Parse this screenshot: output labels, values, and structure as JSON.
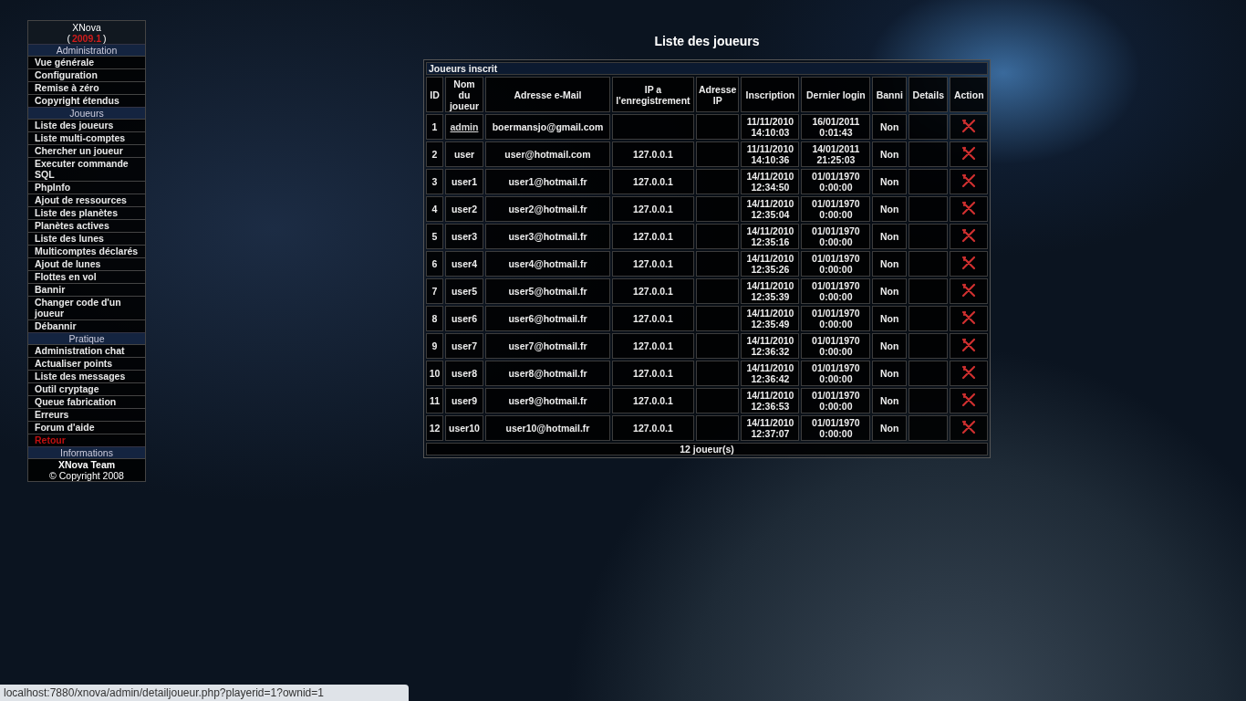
{
  "sidebar": {
    "brand": "XNova",
    "version_prefix": "(",
    "version": "2009.1",
    "version_suffix": ")",
    "sections": [
      {
        "title": "Administration",
        "items": [
          {
            "label": "Vue générale",
            "kind": "link"
          },
          {
            "label": "Configuration",
            "kind": "link"
          },
          {
            "label": "Remise à zéro",
            "kind": "link"
          },
          {
            "label": "Copyright étendus",
            "kind": "link"
          }
        ]
      },
      {
        "title": "Joueurs",
        "items": [
          {
            "label": "Liste des joueurs",
            "kind": "link"
          },
          {
            "label": "Liste multi-comptes",
            "kind": "link"
          },
          {
            "label": "Chercher un joueur",
            "kind": "link"
          },
          {
            "label": "Executer commande SQL",
            "kind": "link"
          },
          {
            "label": "PhpInfo",
            "kind": "link"
          },
          {
            "label": "Ajout de ressources",
            "kind": "link"
          },
          {
            "label": "Liste des planètes",
            "kind": "link"
          },
          {
            "label": "Planètes actives",
            "kind": "link"
          },
          {
            "label": "Liste des lunes",
            "kind": "link"
          },
          {
            "label": "Multicomptes déclarés",
            "kind": "link"
          },
          {
            "label": "Ajout de lunes",
            "kind": "link"
          },
          {
            "label": "Flottes en vol",
            "kind": "link"
          },
          {
            "label": "Bannir",
            "kind": "link"
          },
          {
            "label": "Changer code d'un joueur",
            "kind": "link"
          },
          {
            "label": "Débannir",
            "kind": "link"
          }
        ]
      },
      {
        "title": "Pratique",
        "items": [
          {
            "label": "Administration chat",
            "kind": "link"
          },
          {
            "label": "Actualiser points",
            "kind": "link"
          },
          {
            "label": "Liste des messages",
            "kind": "link"
          },
          {
            "label": "Outil cryptage",
            "kind": "link"
          },
          {
            "label": "Queue fabrication",
            "kind": "link"
          },
          {
            "label": "Erreurs",
            "kind": "link"
          },
          {
            "label": "Forum d'aide",
            "kind": "link"
          },
          {
            "label": "Retour",
            "kind": "exit"
          }
        ]
      },
      {
        "title": "Informations"
      }
    ],
    "footer": [
      "XNova Team",
      "© Copyright 2008"
    ]
  },
  "page_title": "Liste des joueurs",
  "table": {
    "caption": "Joueurs inscrit",
    "columns": [
      "ID",
      "Nom du joueur",
      "Adresse e-Mail",
      "IP a l'enregistrement",
      "Adresse IP",
      "Inscription",
      "Dernier login",
      "Banni",
      "Details",
      "Action"
    ],
    "rows": [
      {
        "id": "1",
        "name": "admin",
        "name_link": true,
        "email": "boermansjo@gmail.com",
        "ip_registration": "",
        "ip": "",
        "inscription": [
          "11/11/2010",
          "14:10:03"
        ],
        "last_login": [
          "16/01/2011",
          "0:01:43"
        ],
        "banned": "Non"
      },
      {
        "id": "2",
        "name": "user",
        "name_link": false,
        "email": "user@hotmail.com",
        "ip_registration": "127.0.0.1",
        "ip": "",
        "inscription": [
          "11/11/2010",
          "14:10:36"
        ],
        "last_login": [
          "14/01/2011",
          "21:25:03"
        ],
        "banned": "Non"
      },
      {
        "id": "3",
        "name": "user1",
        "name_link": false,
        "email": "user1@hotmail.fr",
        "ip_registration": "127.0.0.1",
        "ip": "",
        "inscription": [
          "14/11/2010",
          "12:34:50"
        ],
        "last_login": [
          "01/01/1970",
          "0:00:00"
        ],
        "banned": "Non"
      },
      {
        "id": "4",
        "name": "user2",
        "name_link": false,
        "email": "user2@hotmail.fr",
        "ip_registration": "127.0.0.1",
        "ip": "",
        "inscription": [
          "14/11/2010",
          "12:35:04"
        ],
        "last_login": [
          "01/01/1970",
          "0:00:00"
        ],
        "banned": "Non"
      },
      {
        "id": "5",
        "name": "user3",
        "name_link": false,
        "email": "user3@hotmail.fr",
        "ip_registration": "127.0.0.1",
        "ip": "",
        "inscription": [
          "14/11/2010",
          "12:35:16"
        ],
        "last_login": [
          "01/01/1970",
          "0:00:00"
        ],
        "banned": "Non"
      },
      {
        "id": "6",
        "name": "user4",
        "name_link": false,
        "email": "user4@hotmail.fr",
        "ip_registration": "127.0.0.1",
        "ip": "",
        "inscription": [
          "14/11/2010",
          "12:35:26"
        ],
        "last_login": [
          "01/01/1970",
          "0:00:00"
        ],
        "banned": "Non"
      },
      {
        "id": "7",
        "name": "user5",
        "name_link": false,
        "email": "user5@hotmail.fr",
        "ip_registration": "127.0.0.1",
        "ip": "",
        "inscription": [
          "14/11/2010",
          "12:35:39"
        ],
        "last_login": [
          "01/01/1970",
          "0:00:00"
        ],
        "banned": "Non"
      },
      {
        "id": "8",
        "name": "user6",
        "name_link": false,
        "email": "user6@hotmail.fr",
        "ip_registration": "127.0.0.1",
        "ip": "",
        "inscription": [
          "14/11/2010",
          "12:35:49"
        ],
        "last_login": [
          "01/01/1970",
          "0:00:00"
        ],
        "banned": "Non"
      },
      {
        "id": "9",
        "name": "user7",
        "name_link": false,
        "email": "user7@hotmail.fr",
        "ip_registration": "127.0.0.1",
        "ip": "",
        "inscription": [
          "14/11/2010",
          "12:36:32"
        ],
        "last_login": [
          "01/01/1970",
          "0:00:00"
        ],
        "banned": "Non"
      },
      {
        "id": "10",
        "name": "user8",
        "name_link": false,
        "email": "user8@hotmail.fr",
        "ip_registration": "127.0.0.1",
        "ip": "",
        "inscription": [
          "14/11/2010",
          "12:36:42"
        ],
        "last_login": [
          "01/01/1970",
          "0:00:00"
        ],
        "banned": "Non"
      },
      {
        "id": "11",
        "name": "user9",
        "name_link": false,
        "email": "user9@hotmail.fr",
        "ip_registration": "127.0.0.1",
        "ip": "",
        "inscription": [
          "14/11/2010",
          "12:36:53"
        ],
        "last_login": [
          "01/01/1970",
          "0:00:00"
        ],
        "banned": "Non"
      },
      {
        "id": "12",
        "name": "user10",
        "name_link": false,
        "email": "user10@hotmail.fr",
        "ip_registration": "127.0.0.1",
        "ip": "",
        "inscription": [
          "14/11/2010",
          "12:37:07"
        ],
        "last_login": [
          "01/01/1970",
          "0:00:00"
        ],
        "banned": "Non"
      }
    ],
    "footer": "12 joueur(s)"
  },
  "status_bar": "localhost:7880/xnova/admin/detailjoueur.php?playerid=1?ownid=1"
}
